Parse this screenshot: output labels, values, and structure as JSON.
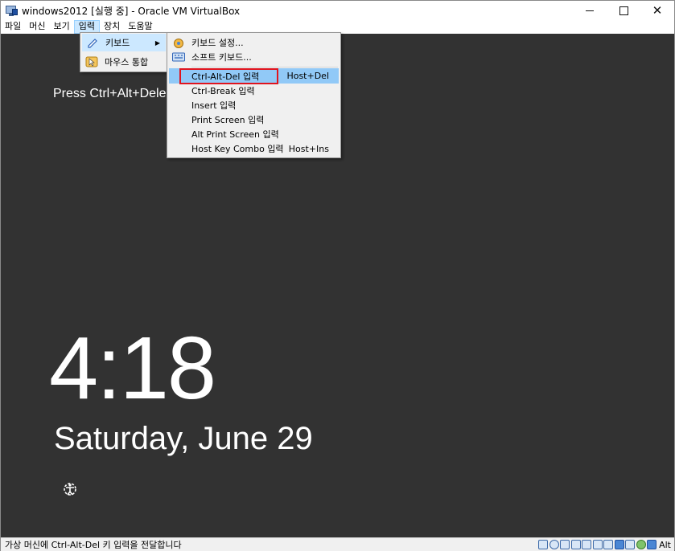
{
  "window": {
    "title": "windows2012 [실행 중] - Oracle VM VirtualBox",
    "minimize": "",
    "maximize": "",
    "close": "✕"
  },
  "menubar": {
    "items": [
      "파일",
      "머신",
      "보기",
      "입력",
      "장치",
      "도움말"
    ],
    "active": "입력"
  },
  "input_menu": {
    "items": [
      {
        "label": "키보드",
        "icon": "keyboard-pencil-icon",
        "has_submenu": true
      },
      {
        "label": "마우스 통합",
        "icon": "mouse-integration-icon",
        "has_submenu": false
      }
    ]
  },
  "keyboard_submenu": {
    "items": [
      {
        "label": "키보드 설정...",
        "shortcut": "",
        "icon": "keyboard-settings-icon"
      },
      {
        "label": "소프트 키보드...",
        "shortcut": "",
        "icon": "soft-keyboard-icon"
      },
      {
        "label": "Ctrl-Alt-Del 입력",
        "shortcut": "Host+Del",
        "icon": ""
      },
      {
        "label": "Ctrl-Break 입력",
        "shortcut": "",
        "icon": ""
      },
      {
        "label": "Insert 입력",
        "shortcut": "",
        "icon": ""
      },
      {
        "label": "Print Screen 입력",
        "shortcut": "",
        "icon": ""
      },
      {
        "label": "Alt Print Screen 입력",
        "shortcut": "",
        "icon": ""
      },
      {
        "label": "Host Key Combo 입력",
        "shortcut": "Host+Ins",
        "icon": ""
      }
    ],
    "highlighted": "Ctrl-Alt-Del 입력"
  },
  "vm_screen": {
    "press_text": "Press Ctrl+Alt+Dele",
    "time": "4:18",
    "date": "Saturday, June 29",
    "ease_icon": "ease-of-access-icon"
  },
  "statusbar": {
    "message": "가상 머신에 Ctrl-Alt-Del 키 입력을 전달합니다",
    "host_key": "Alt",
    "icons": [
      "hard-disk-icon",
      "optical-drive-icon",
      "audio-icon",
      "network-icon",
      "usb-icon",
      "shared-folder-icon",
      "display-icon",
      "recording-icon",
      "cpu-icon",
      "mouse-icon",
      "keyboard-capture-icon"
    ]
  },
  "colors": {
    "vm_background": "#323232",
    "menu_highlight": "#91c9f7",
    "annotation_box": "#e0141e"
  }
}
